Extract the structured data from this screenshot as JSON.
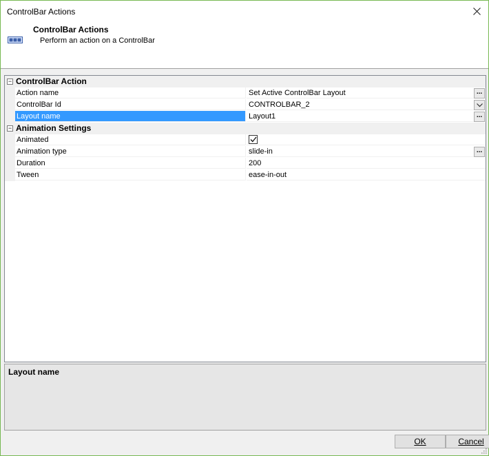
{
  "window": {
    "title": "ControlBar Actions"
  },
  "header": {
    "title": "ControlBar Actions",
    "description": "Perform an action on a ControlBar",
    "icon": "controlbar-icon"
  },
  "grid": {
    "categories": [
      {
        "label": "ControlBar Action",
        "expanded": true,
        "properties": [
          {
            "name": "Action name",
            "value": "Set Active ControlBar Layout",
            "editor": "ellipsis"
          },
          {
            "name": "ControlBar Id",
            "value": "CONTROLBAR_2",
            "editor": "dropdown"
          },
          {
            "name": "Layout name",
            "value": "Layout1",
            "editor": "ellipsis",
            "selected": true
          }
        ]
      },
      {
        "label": "Animation Settings",
        "expanded": true,
        "properties": [
          {
            "name": "Animated",
            "value": "",
            "checked": true,
            "editor": "checkbox"
          },
          {
            "name": "Animation type",
            "value": "slide-in",
            "editor": "ellipsis"
          },
          {
            "name": "Duration",
            "value": "200"
          },
          {
            "name": "Tween",
            "value": "ease-in-out"
          }
        ]
      }
    ],
    "ellipsis_label": "...",
    "collapse_symbol": "−"
  },
  "help": {
    "title": "Layout name"
  },
  "buttons": {
    "ok": "OK",
    "cancel": "Cancel"
  },
  "colors": {
    "accent_border": "#76b852",
    "selection": "#3399ff"
  }
}
